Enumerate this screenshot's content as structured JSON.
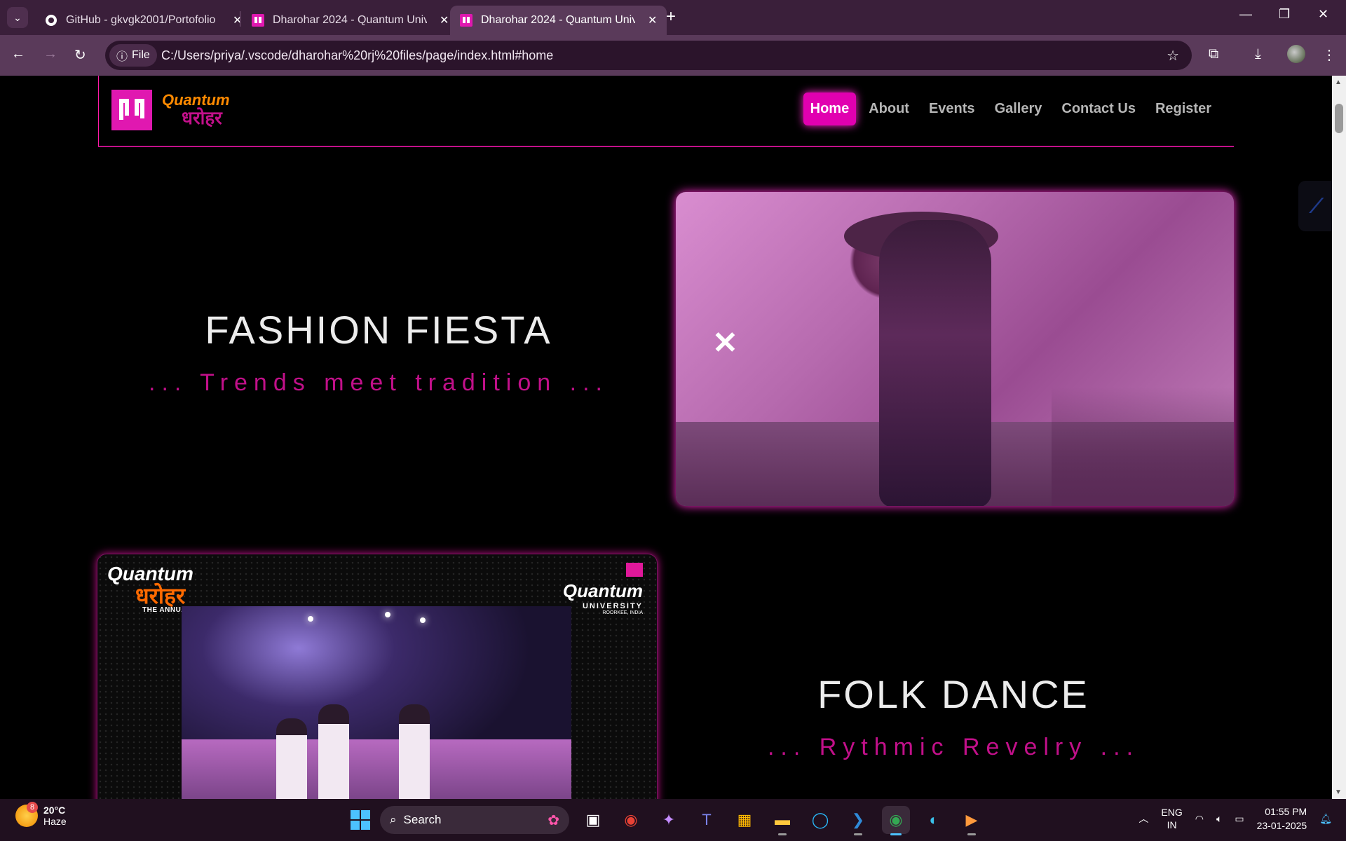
{
  "browser": {
    "tabs": [
      {
        "title": "GitHub - gkvgk2001/Portofolio",
        "active": false
      },
      {
        "title": "Dharohar 2024 - Quantum Univ",
        "active": false
      },
      {
        "title": "Dharohar 2024 - Quantum Univ",
        "active": true
      }
    ],
    "file_chip": "File",
    "url": "C:/Users/priya/.vscode/dharohar%20rj%20files/page/index.html#home"
  },
  "site": {
    "logo": {
      "brand": "Quantum",
      "script": "धरोहर"
    },
    "nav": [
      "Home",
      "About",
      "Events",
      "Gallery",
      "Contact Us",
      "Register"
    ],
    "active_nav": "Home",
    "events": [
      {
        "title": "FASHION FIESTA",
        "tagline": "... Trends meet tradition ..."
      },
      {
        "title": "FOLK DANCE",
        "tagline": "... Rythmic Revelry ..."
      }
    ],
    "banner": {
      "left_brand": "Quantum",
      "left_script": "धरोहर",
      "left_caption": "THE ANNUAL FEST",
      "right_brand": "Quantum",
      "right_sub": "UNIVERSITY",
      "right_place": "ROORKEE, INDIA"
    }
  },
  "taskbar": {
    "weather": {
      "badge": "8",
      "temp": "20°C",
      "condition": "Haze"
    },
    "search": "Search",
    "lang": [
      "ENG",
      "IN"
    ],
    "time": "01:55 PM",
    "date": "23-01-2025"
  },
  "colors": {
    "accent": "#e100b0",
    "tagline": "#c2108a",
    "chrome": "#3a1f3a"
  }
}
